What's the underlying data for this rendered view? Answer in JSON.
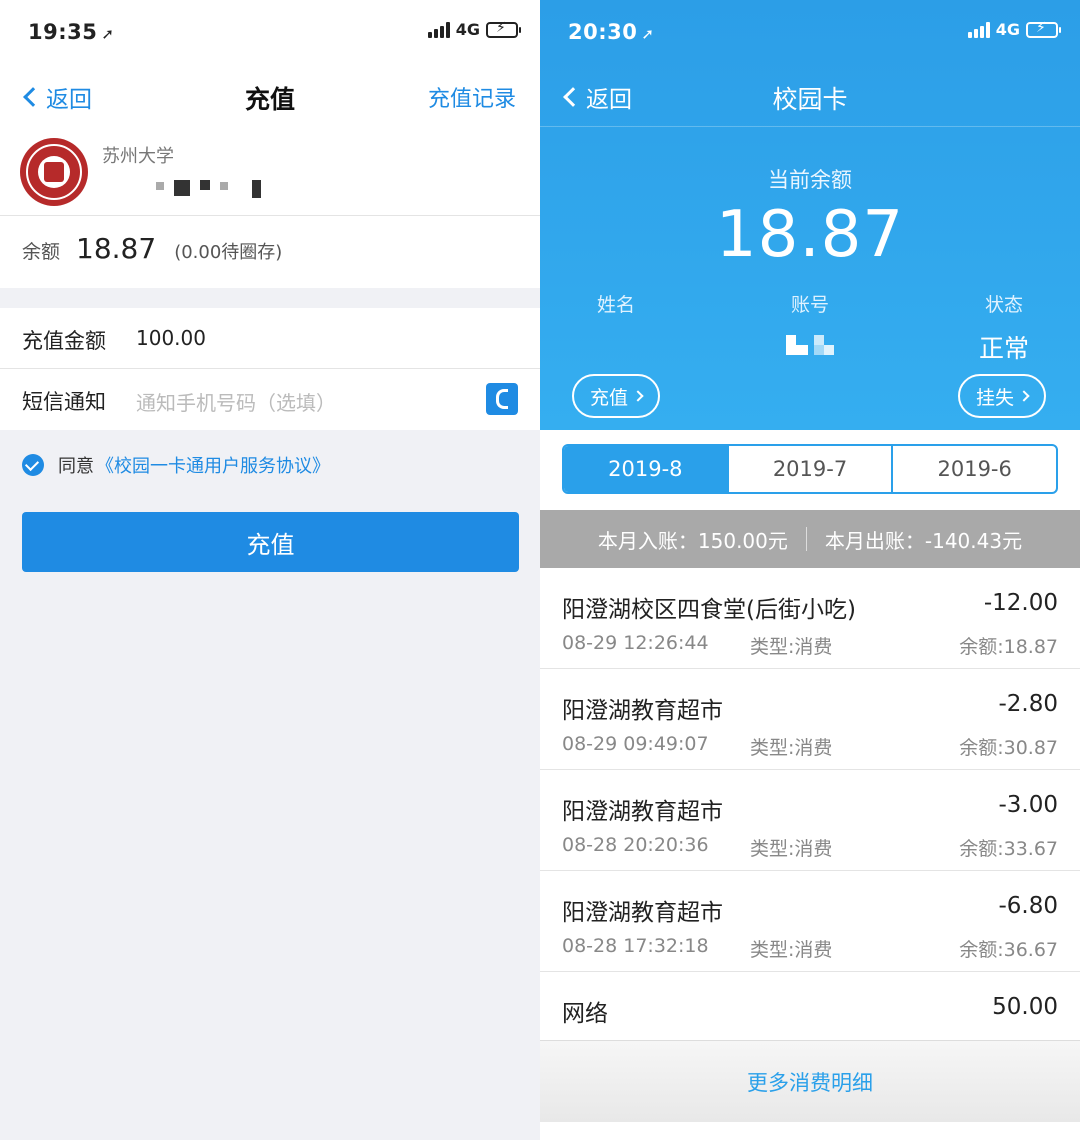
{
  "left": {
    "status": {
      "time": "19:35",
      "network": "4G"
    },
    "nav": {
      "back": "返回",
      "title": "充值",
      "right": "充值记录"
    },
    "card": {
      "school": "苏州大学",
      "balance_label": "余额",
      "balance": "18.87",
      "pending": "(0.00待圈存)"
    },
    "form": {
      "amount_label": "充值金额",
      "amount_value": "100.00",
      "sms_label": "短信通知",
      "sms_placeholder": "通知手机号码（选填）"
    },
    "agreement": {
      "prefix": "同意",
      "link": "《校园一卡通用户服务协议》"
    },
    "submit": "充值"
  },
  "right": {
    "status": {
      "time": "20:30",
      "network": "4G"
    },
    "nav": {
      "back": "返回",
      "title": "校园卡"
    },
    "hero": {
      "balance_label": "当前余额",
      "balance": "18.87",
      "name_label": "姓名",
      "account_label": "账号",
      "status_label": "状态",
      "status_value": "正常",
      "recharge_btn": "充值",
      "report_lost_btn": "挂失"
    },
    "tabs": [
      {
        "label": "2019-8",
        "active": true
      },
      {
        "label": "2019-7",
        "active": false
      },
      {
        "label": "2019-6",
        "active": false
      }
    ],
    "summary": {
      "income": "本月入账：150.00元",
      "expense": "本月出账：-140.43元"
    },
    "transactions": [
      {
        "name": "阳澄湖校区四食堂(后街小吃)",
        "amount": "-12.00",
        "time": "08-29 12:26:44",
        "type": "类型:消费",
        "balance": "余额:18.87"
      },
      {
        "name": "阳澄湖教育超市",
        "amount": "-2.80",
        "time": "08-29 09:49:07",
        "type": "类型:消费",
        "balance": "余额:30.87"
      },
      {
        "name": "阳澄湖教育超市",
        "amount": "-3.00",
        "time": "08-28 20:20:36",
        "type": "类型:消费",
        "balance": "余额:33.67"
      },
      {
        "name": "阳澄湖教育超市",
        "amount": "-6.80",
        "time": "08-28 17:32:18",
        "type": "类型:消费",
        "balance": "余额:36.67"
      },
      {
        "name": "网络",
        "amount": "50.00"
      }
    ],
    "more": "更多消费明细"
  },
  "colors": {
    "accent": "#1f8be3",
    "hero": "#35aef0",
    "summary_bg": "#a9a9a9"
  },
  "icons": [
    "back-chevron-icon",
    "location-arrow-icon",
    "signal-icon",
    "battery-charging-icon",
    "phone-book-icon",
    "checkmark-icon",
    "university-seal-icon",
    "chevron-right-icon"
  ]
}
